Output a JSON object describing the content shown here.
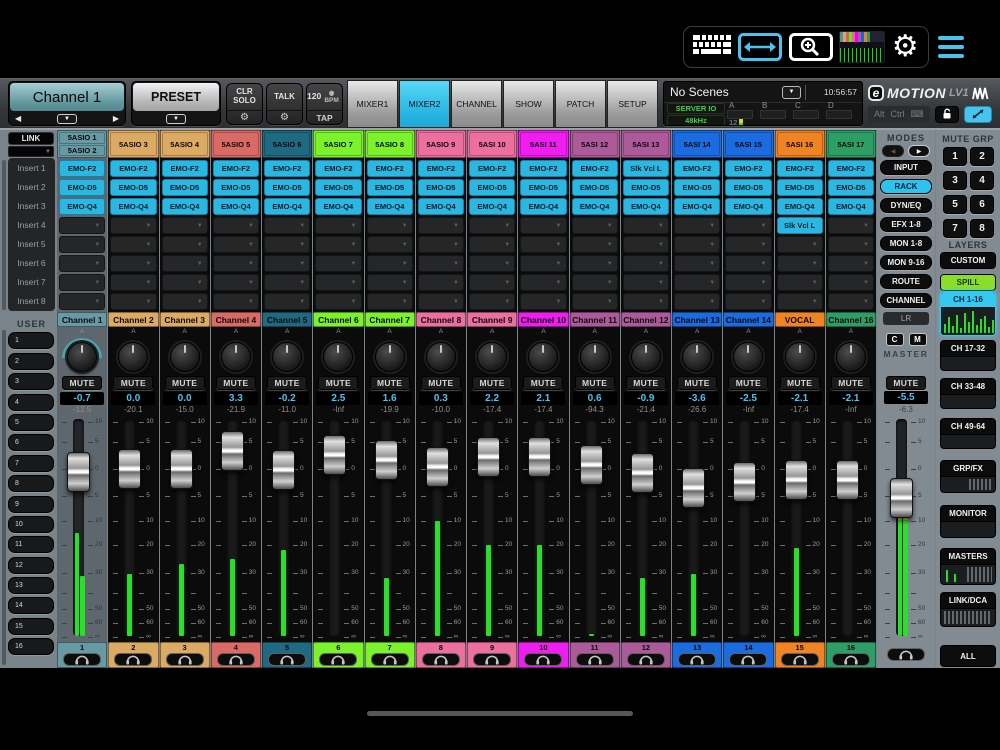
{
  "statusbar": {
    "icons": [
      "keyboard-icon",
      "screen-width-icon",
      "zoom-icon",
      "screens-thumbnail",
      "settings-gear-icon",
      "menu-icon"
    ]
  },
  "toolbar": {
    "channel_selector": {
      "value": "Channel 1"
    },
    "preset_label": "PRESET",
    "clr_solo_label": "CLR\nSOLO",
    "talk_label": "TALK",
    "bpm_value": "120",
    "bpm_label": "BPM",
    "tap_label": "TAP",
    "tabs": [
      {
        "label": "MIXER1",
        "active": false
      },
      {
        "label": "MIXER2",
        "active": true
      },
      {
        "label": "CHANNEL",
        "active": false
      },
      {
        "label": "SHOW",
        "active": false
      },
      {
        "label": "PATCH",
        "active": false
      },
      {
        "label": "SETUP",
        "active": false
      }
    ],
    "scene": {
      "name": "No Scenes",
      "time": "10:56:57",
      "server_label": "SERVER IO",
      "sample_rate": "48kHz",
      "slots": [
        "A",
        "B",
        "C",
        "D"
      ],
      "slot_a_count": "12"
    },
    "logo": {
      "e": "e",
      "brand": "MOTION",
      "model": "LV1"
    },
    "alt_label": "Alt",
    "ctrl_label": "Ctrl"
  },
  "left_rail": {
    "link_label": "LINK",
    "insert_labels": [
      "Insert 1",
      "Insert 2",
      "Insert 3",
      "Insert 4",
      "Insert 5",
      "Insert 6",
      "Insert 7",
      "Insert 8"
    ],
    "user_label": "USER",
    "user_buttons": [
      "1",
      "2",
      "3",
      "4",
      "5",
      "6",
      "7",
      "8",
      "9",
      "10",
      "11",
      "12",
      "13",
      "14",
      "15",
      "16"
    ]
  },
  "mixer": {
    "fader_scale": [
      {
        "db": 10,
        "label": "10"
      },
      {
        "db": 5,
        "label": "5"
      },
      {
        "db": 0,
        "label": "0"
      },
      {
        "db": -5,
        "label": "5"
      },
      {
        "db": -10,
        "label": "10"
      },
      {
        "db": -20,
        "label": "20"
      },
      {
        "db": -30,
        "label": "30"
      },
      {
        "db": -40,
        "label": ""
      },
      {
        "db": -50,
        "label": "50"
      },
      {
        "db": -60,
        "label": "60"
      },
      {
        "db": -101,
        "label": "∞"
      }
    ],
    "mute_label": "MUTE",
    "channels": [
      {
        "num": "1",
        "sources": [
          "5ASIO 1",
          "5ASIO 2"
        ],
        "color": "#679aa4",
        "name": "Channel 1",
        "bus": "A",
        "inserts": [
          "EMO-F2",
          "EMO-D5",
          "EMO-Q4",
          "",
          "",
          "",
          "",
          ""
        ],
        "gain": "-0.7",
        "peak": "-12.5",
        "gain_db": -0.7,
        "meters": [
          -15,
          -32
        ],
        "selected": true,
        "knob_arc": true
      },
      {
        "num": "2",
        "sources": [
          "5ASIO 3"
        ],
        "color": "#ddaa64",
        "name": "Channel 2",
        "bus": "A",
        "inserts": [
          "EMO-F2",
          "EMO-D5",
          "EMO-Q4",
          "",
          "",
          "",
          "",
          ""
        ],
        "gain": "0.0",
        "peak": "-20.1",
        "gain_db": 0.0,
        "meters": [
          -31
        ],
        "selected": false,
        "knob_arc": false
      },
      {
        "num": "3",
        "sources": [
          "5ASIO 4"
        ],
        "color": "#ddaa64",
        "name": "Channel 3",
        "bus": "A",
        "inserts": [
          "EMO-F2",
          "EMO-D5",
          "EMO-Q4",
          "",
          "",
          "",
          "",
          ""
        ],
        "gain": "0.0",
        "peak": "-15.0",
        "gain_db": 0.0,
        "meters": [
          -27
        ],
        "selected": false,
        "knob_arc": false
      },
      {
        "num": "4",
        "sources": [
          "5ASIO 5"
        ],
        "color": "#da6a65",
        "name": "Channel 4",
        "bus": "A",
        "inserts": [
          "EMO-F2",
          "EMO-D5",
          "EMO-Q4",
          "",
          "",
          "",
          "",
          ""
        ],
        "gain": "3.3",
        "peak": "-21.9",
        "gain_db": 3.3,
        "meters": [
          -25
        ],
        "selected": false,
        "knob_arc": false
      },
      {
        "num": "5",
        "sources": [
          "5ASIO 6"
        ],
        "color": "#1f6a82",
        "name": "Channel 5",
        "bus": "A",
        "inserts": [
          "EMO-F2",
          "EMO-D5",
          "EMO-Q4",
          "",
          "",
          "",
          "",
          ""
        ],
        "gain": "-0.2",
        "peak": "-11.0",
        "gain_db": -0.2,
        "meters": [
          -22
        ],
        "selected": false,
        "knob_arc": false
      },
      {
        "num": "6",
        "sources": [
          "5ASIO 7"
        ],
        "color": "#7cf22c",
        "name": "Channel 6",
        "bus": "A",
        "inserts": [
          "EMO-F2",
          "EMO-D5",
          "EMO-Q4",
          "",
          "",
          "",
          "",
          ""
        ],
        "gain": "2.5",
        "peak": "-Inf",
        "gain_db": 2.5,
        "meters": [],
        "selected": false,
        "knob_arc": false
      },
      {
        "num": "7",
        "sources": [
          "5ASIO 8"
        ],
        "color": "#7cf22c",
        "name": "Channel 7",
        "bus": "A",
        "inserts": [
          "EMO-F2",
          "EMO-D5",
          "EMO-Q4",
          "",
          "",
          "",
          "",
          ""
        ],
        "gain": "1.6",
        "peak": "-19.9",
        "gain_db": 1.6,
        "meters": [
          -33
        ],
        "selected": false,
        "knob_arc": false
      },
      {
        "num": "8",
        "sources": [
          "5ASIO 9"
        ],
        "color": "#ec6f9f",
        "name": "Channel 8",
        "bus": "A",
        "inserts": [
          "EMO-F2",
          "EMO-D5",
          "EMO-Q4",
          "",
          "",
          "",
          "",
          ""
        ],
        "gain": "0.3",
        "peak": "-10.0",
        "gain_db": 0.3,
        "meters": [
          -10
        ],
        "selected": false,
        "knob_arc": false
      },
      {
        "num": "9",
        "sources": [
          "5ASI 10"
        ],
        "color": "#ec6f9f",
        "name": "Channel 9",
        "bus": "A",
        "inserts": [
          "EMO-F2",
          "EMO-D5",
          "EMO-Q4",
          "",
          "",
          "",
          "",
          ""
        ],
        "gain": "2.2",
        "peak": "-17.4",
        "gain_db": 2.2,
        "meters": [
          -20
        ],
        "selected": false,
        "knob_arc": false
      },
      {
        "num": "10",
        "sources": [
          "5ASI 11"
        ],
        "color": "#f01df0",
        "name": "Channel 10",
        "bus": "A",
        "inserts": [
          "EMO-F2",
          "EMO-D5",
          "EMO-Q4",
          "",
          "",
          "",
          "",
          ""
        ],
        "gain": "2.1",
        "peak": "-17.4",
        "gain_db": 2.1,
        "meters": [
          -20
        ],
        "selected": false,
        "knob_arc": false
      },
      {
        "num": "11",
        "sources": [
          "5ASI 12"
        ],
        "color": "#ac5a99",
        "name": "Channel 11",
        "bus": "A",
        "inserts": [
          "EMO-F2",
          "EMO-D5",
          "EMO-Q4",
          "",
          "",
          "",
          "",
          ""
        ],
        "gain": "0.6",
        "peak": "-94.3",
        "gain_db": 0.6,
        "meters": [
          -94
        ],
        "selected": false,
        "knob_arc": false
      },
      {
        "num": "12",
        "sources": [
          "5ASI 13"
        ],
        "color": "#ac5a99",
        "name": "Channel 12",
        "bus": "A",
        "inserts": [
          "Slk Vcl L",
          "EMO-D5",
          "EMO-Q4",
          "",
          "",
          "",
          "",
          ""
        ],
        "gain": "-0.9",
        "peak": "-21.4",
        "gain_db": -0.9,
        "meters": [
          -33
        ],
        "selected": false,
        "knob_arc": false
      },
      {
        "num": "13",
        "sources": [
          "5ASI 14"
        ],
        "color": "#1a6ce0",
        "name": "Channel 13",
        "bus": "A",
        "inserts": [
          "EMO-F2",
          "EMO-D5",
          "EMO-Q4",
          "",
          "",
          "",
          "",
          ""
        ],
        "gain": "-3.6",
        "peak": "-26.6",
        "gain_db": -3.6,
        "meters": [
          -31
        ],
        "selected": false,
        "knob_arc": false
      },
      {
        "num": "14",
        "sources": [
          "5ASI 15"
        ],
        "color": "#1a6ce0",
        "name": "Channel 14",
        "bus": "A",
        "inserts": [
          "EMO-F2",
          "EMO-D5",
          "EMO-Q4",
          "",
          "",
          "",
          "",
          ""
        ],
        "gain": "-2.5",
        "peak": "-Inf",
        "gain_db": -2.5,
        "meters": [],
        "selected": false,
        "knob_arc": false
      },
      {
        "num": "15",
        "sources": [
          "5ASI 16"
        ],
        "color": "#f08424",
        "name": "VOCAL",
        "bus": "A",
        "inserts": [
          "EMO-F2",
          "EMO-D5",
          "EMO-Q4",
          "Slk Vcl L",
          "",
          "",
          "",
          ""
        ],
        "gain": "-2.1",
        "peak": "-17.4",
        "gain_db": -2.1,
        "meters": [
          -21
        ],
        "selected": false,
        "knob_arc": false
      },
      {
        "num": "16",
        "sources": [
          "5ASI 17"
        ],
        "color": "#2d9e66",
        "name": "Channel 16",
        "bus": "A",
        "inserts": [
          "EMO-F2",
          "EMO-D5",
          "EMO-Q4",
          "",
          "",
          "",
          "",
          ""
        ],
        "gain": "-2.1",
        "peak": "-Inf",
        "gain_db": -2.1,
        "meters": [],
        "selected": false,
        "knob_arc": false
      }
    ],
    "master": {
      "bus_label": "LR",
      "c_label": "C",
      "m_label": "M",
      "name": "MASTER",
      "mute_label": "MUTE",
      "gain": "-5.5",
      "peak": "-6.3",
      "gain_db": -5.5,
      "meters": [
        -8.5,
        -8.5
      ],
      "meter_yellow": true
    }
  },
  "modes": {
    "title": "MODES",
    "buttons": [
      {
        "label": "INPUT",
        "active": false
      },
      {
        "label": "RACK",
        "active": true
      },
      {
        "label": "DYN/EQ",
        "active": false
      },
      {
        "label": "EFX 1-8",
        "active": false
      },
      {
        "label": "MON 1-8",
        "active": false
      },
      {
        "label": "MON 9-16",
        "active": false
      },
      {
        "label": "ROUTE",
        "active": false
      },
      {
        "label": "CHANNEL",
        "active": false
      }
    ]
  },
  "right_rail": {
    "mute_grp_title": "MUTE GRP",
    "mute_grp_buttons": [
      "1",
      "2",
      "3",
      "4",
      "5",
      "6",
      "7",
      "8"
    ],
    "layers_title": "LAYERS",
    "ch_meter_bars": [
      9,
      16,
      7,
      18,
      5,
      20,
      11,
      22,
      8,
      14,
      17,
      6,
      13
    ],
    "masters_meter_bars": [
      12,
      8
    ],
    "layers": [
      {
        "label": "CUSTOM",
        "style": "plain"
      },
      {
        "label": "SPILL",
        "style": "green"
      },
      {
        "label": "CH 1-16",
        "style": "selected",
        "meter": "channels"
      },
      {
        "label": "CH 17-32",
        "style": "panel"
      },
      {
        "label": "CH 33-48",
        "style": "panel"
      },
      {
        "label": "CH 49-64",
        "style": "panel"
      },
      {
        "label": "GRP/FX",
        "style": "panel",
        "meter": "lines-right"
      },
      {
        "label": "MONITOR",
        "style": "panel"
      },
      {
        "label": "MASTERS",
        "style": "panel",
        "meter": "masters"
      },
      {
        "label": "LINK/DCA",
        "style": "panel",
        "meter": "lines-full"
      },
      {
        "label": "ALL",
        "style": "plain"
      }
    ]
  }
}
